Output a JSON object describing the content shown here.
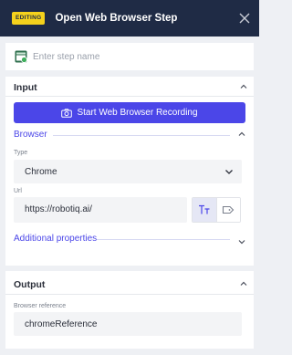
{
  "header": {
    "badge": "EDITING",
    "title": "Open Web Browser Step"
  },
  "step": {
    "placeholder": "Enter step name",
    "value": ""
  },
  "input_panel": {
    "title": "Input",
    "record_button": "Start Web Browser Recording",
    "browser_section": {
      "label": "Browser",
      "type_caption": "Type",
      "type_value": "Chrome",
      "url_caption": "Url",
      "url_value": "https://robotiq.ai/"
    },
    "additional_properties": "Additional properties"
  },
  "output_panel": {
    "title": "Output",
    "browser_reference_caption": "Browser reference",
    "browser_reference_value": "chromeReference"
  },
  "colors": {
    "header_bg": "#1f2b45",
    "badge_bg": "#f5d21c",
    "accent": "#4b46e8",
    "panel_bg": "#ffffff",
    "page_bg": "#eef0f4"
  },
  "icons": {
    "close": "close-icon",
    "step": "browser-step-icon",
    "camera": "camera-icon",
    "collapse": "chevron-up-icon",
    "expand": "chevron-down-icon",
    "text_mode": "text-mode-icon",
    "variable_mode": "variable-tag-icon"
  }
}
